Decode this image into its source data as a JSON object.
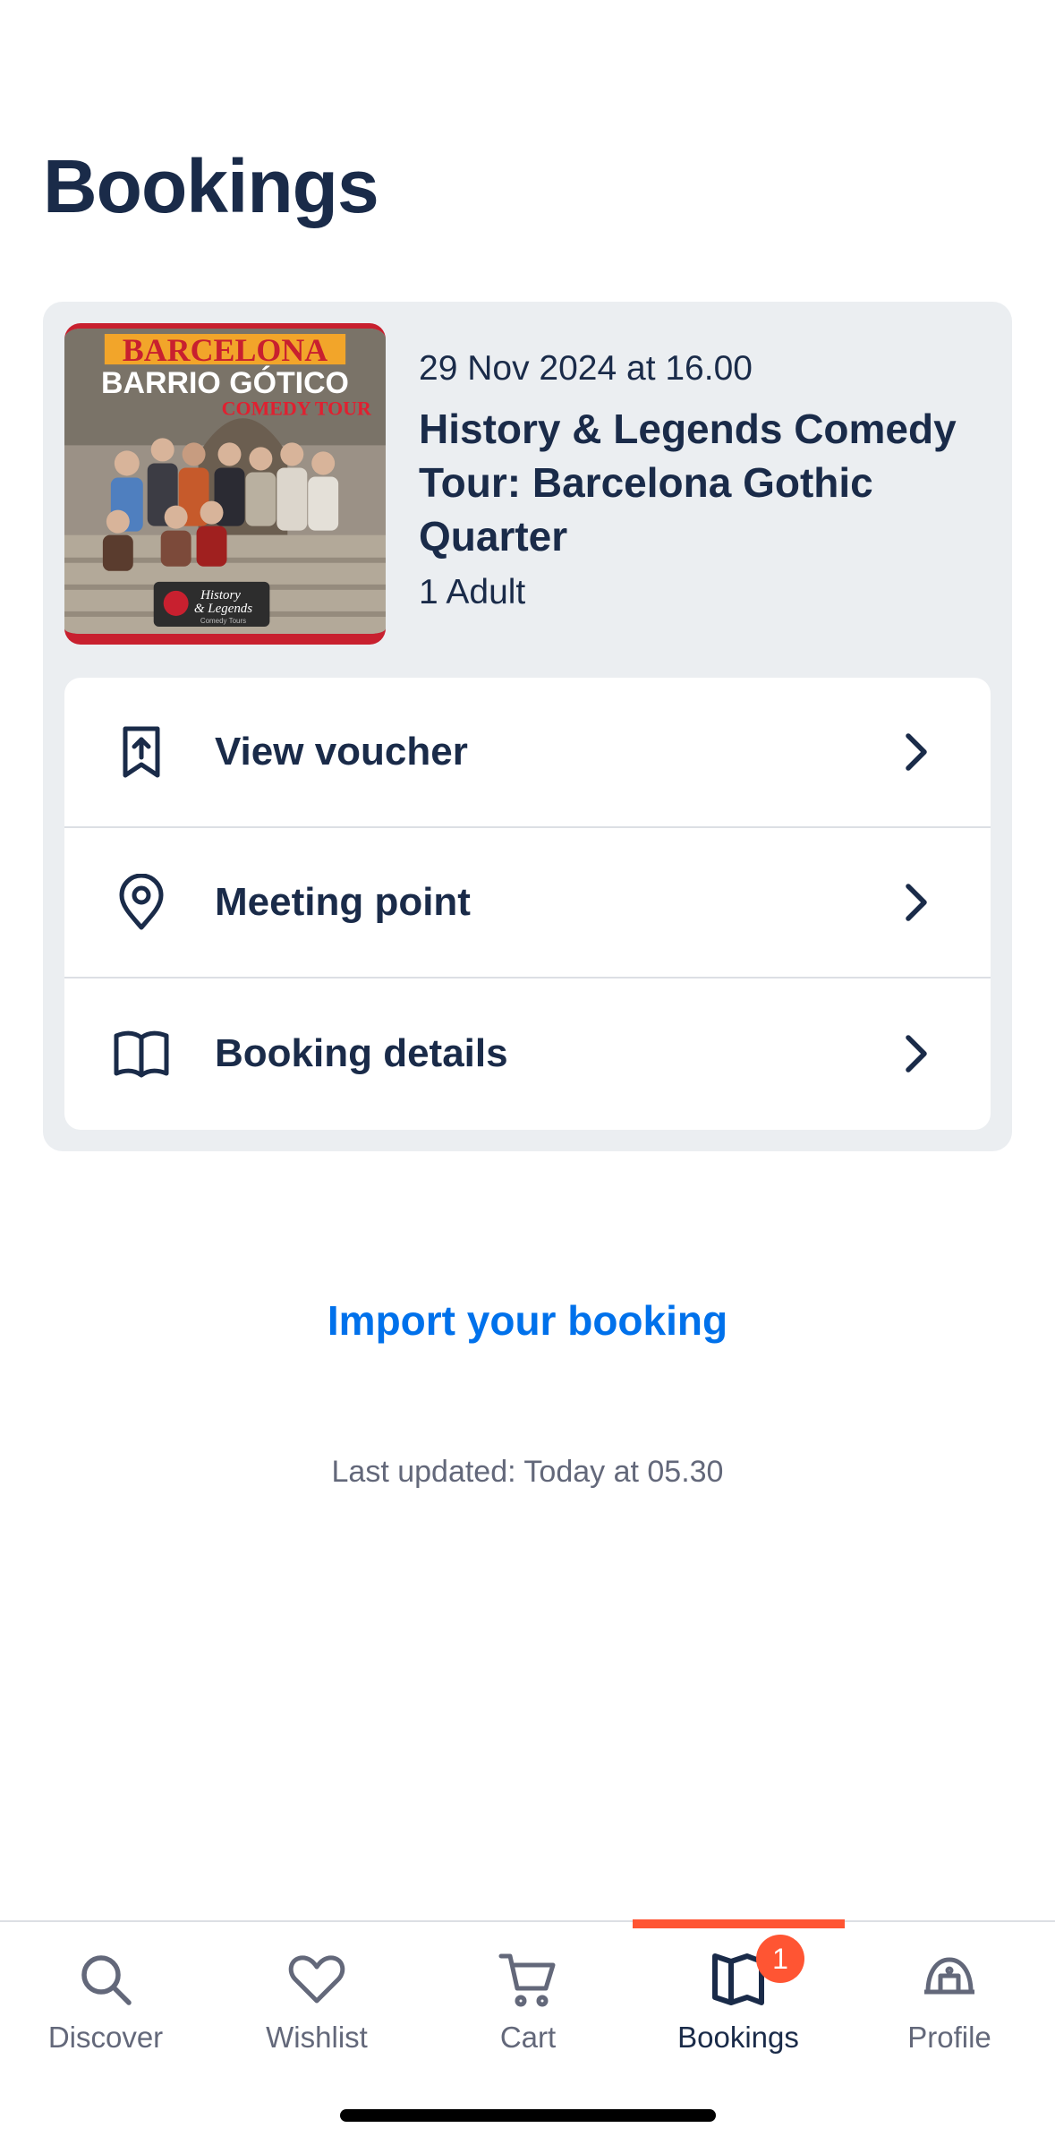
{
  "page": {
    "title": "Bookings"
  },
  "booking": {
    "date": "29 Nov 2024 at 16.00",
    "title": "History & Legends Comedy Tour: Barcelona Gothic Quarter",
    "guests": "1 Adult",
    "image": {
      "line1": "BARCELONA",
      "line2": "BARRIO GÓTICO",
      "line3": "COMEDY TOUR",
      "badge_line1": "History",
      "badge_line2": "& Legends",
      "badge_line3": "Comedy Tours"
    },
    "actions": [
      {
        "label": "View voucher",
        "icon": "voucher-icon"
      },
      {
        "label": "Meeting point",
        "icon": "location-pin-icon"
      },
      {
        "label": "Booking details",
        "icon": "book-icon"
      }
    ]
  },
  "import_link": "Import your booking",
  "last_updated": "Last updated: Today at 05.30",
  "tabbar": {
    "tabs": [
      {
        "label": "Discover",
        "icon": "search-icon"
      },
      {
        "label": "Wishlist",
        "icon": "heart-icon"
      },
      {
        "label": "Cart",
        "icon": "cart-icon"
      },
      {
        "label": "Bookings",
        "icon": "bookings-icon",
        "active": true,
        "badge": "1"
      },
      {
        "label": "Profile",
        "icon": "profile-icon"
      }
    ]
  },
  "colors": {
    "text": "#1a2b49",
    "link": "#0071eb",
    "accent": "#ff5533",
    "card_bg": "#ebeef1"
  }
}
